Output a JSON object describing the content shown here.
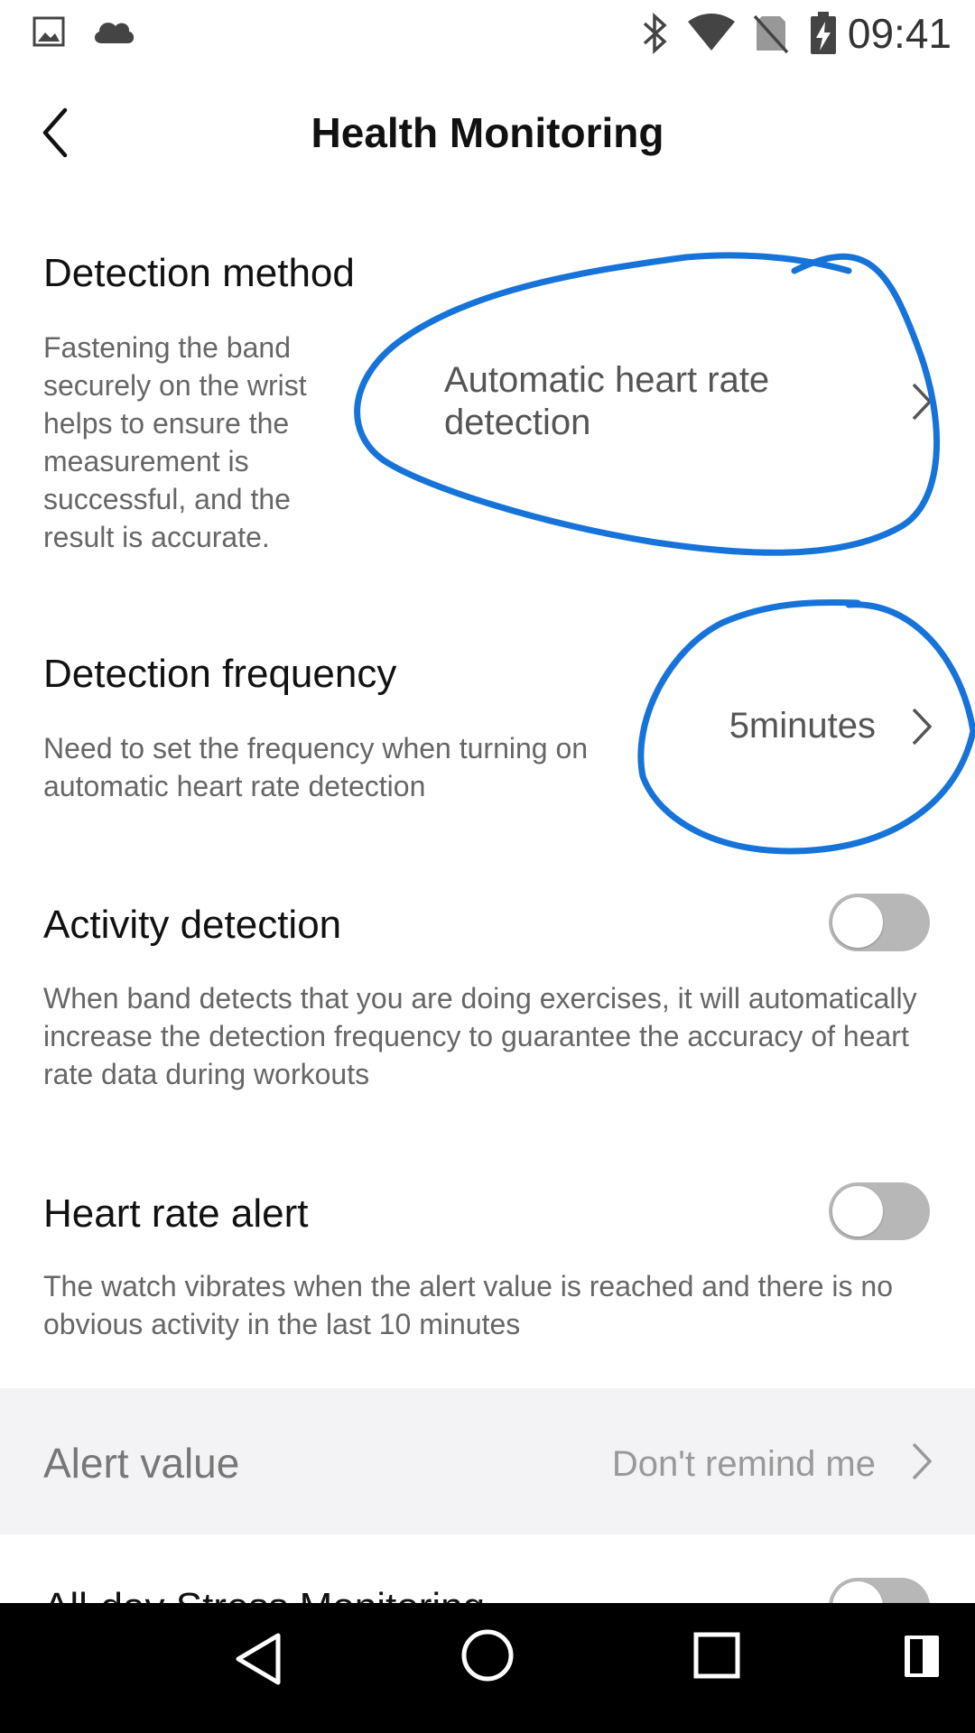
{
  "status_bar": {
    "time": "09:41",
    "left_icons": [
      "image-icon",
      "cloud-icon"
    ],
    "right_icons": [
      "bluetooth-icon",
      "wifi-icon",
      "no-sim-icon",
      "battery-charging-icon"
    ]
  },
  "header": {
    "title": "Health Monitoring",
    "back_icon": "chevron-left-icon"
  },
  "detection_method": {
    "title": "Detection method",
    "description": "Fastening the band securely on the wrist helps to ensure the measurement is successful, and the result is accurate.",
    "value": "Automatic heart rate detection"
  },
  "detection_frequency": {
    "title": "Detection frequency",
    "description": "Need to set the frequency when turning on automatic heart rate detection",
    "value": "5minutes"
  },
  "activity_detection": {
    "title": "Activity detection",
    "description": "When band detects that you are doing exercises, it will automatically increase the detection frequency to guarantee the accuracy of heart rate data during workouts",
    "enabled": false
  },
  "heart_rate_alert": {
    "title": "Heart rate alert",
    "description": "The watch vibrates when the alert value is reached and there is no obvious activity in the last 10 minutes",
    "enabled": false
  },
  "alert_value": {
    "label": "Alert value",
    "value": "Don't remind me"
  },
  "stress_monitoring": {
    "title": "All-day Stress Monitoring",
    "enabled": false
  },
  "nav_bar": {
    "buttons": [
      "back-triangle-icon",
      "home-circle-icon",
      "recents-square-icon",
      "overview-icon"
    ]
  },
  "colors": {
    "annotation": "#1673d9",
    "toggle_off": "#b7b7b7",
    "alert_band_bg": "#f3f3f5"
  }
}
